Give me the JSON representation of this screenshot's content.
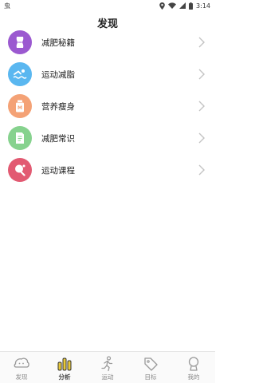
{
  "status_bar": {
    "left_text": "虫",
    "time": "3:14",
    "icons": [
      "location-icon",
      "wifi-icon",
      "signal-icon",
      "battery-icon"
    ]
  },
  "header": {
    "title": "发现"
  },
  "items": [
    {
      "label": "减肥秘籍",
      "icon": "waist-icon",
      "color": "#9b59d0"
    },
    {
      "label": "运动减脂",
      "icon": "swim-icon",
      "color": "#5ab7f0"
    },
    {
      "label": "营养瘦身",
      "icon": "nutrition-bottle-icon",
      "color": "#f4a276"
    },
    {
      "label": "减肥常识",
      "icon": "document-icon",
      "color": "#86d28e"
    },
    {
      "label": "运动课程",
      "icon": "pingpong-icon",
      "color": "#e25a72"
    }
  ],
  "tabs": [
    {
      "label": "发现",
      "icon": "discover-icon",
      "active": false
    },
    {
      "label": "分析",
      "icon": "bar-chart-icon",
      "active": true
    },
    {
      "label": "运动",
      "icon": "running-icon",
      "active": false
    },
    {
      "label": "目标",
      "icon": "tag-icon",
      "active": false
    },
    {
      "label": "我的",
      "icon": "profile-icon",
      "active": false
    }
  ]
}
